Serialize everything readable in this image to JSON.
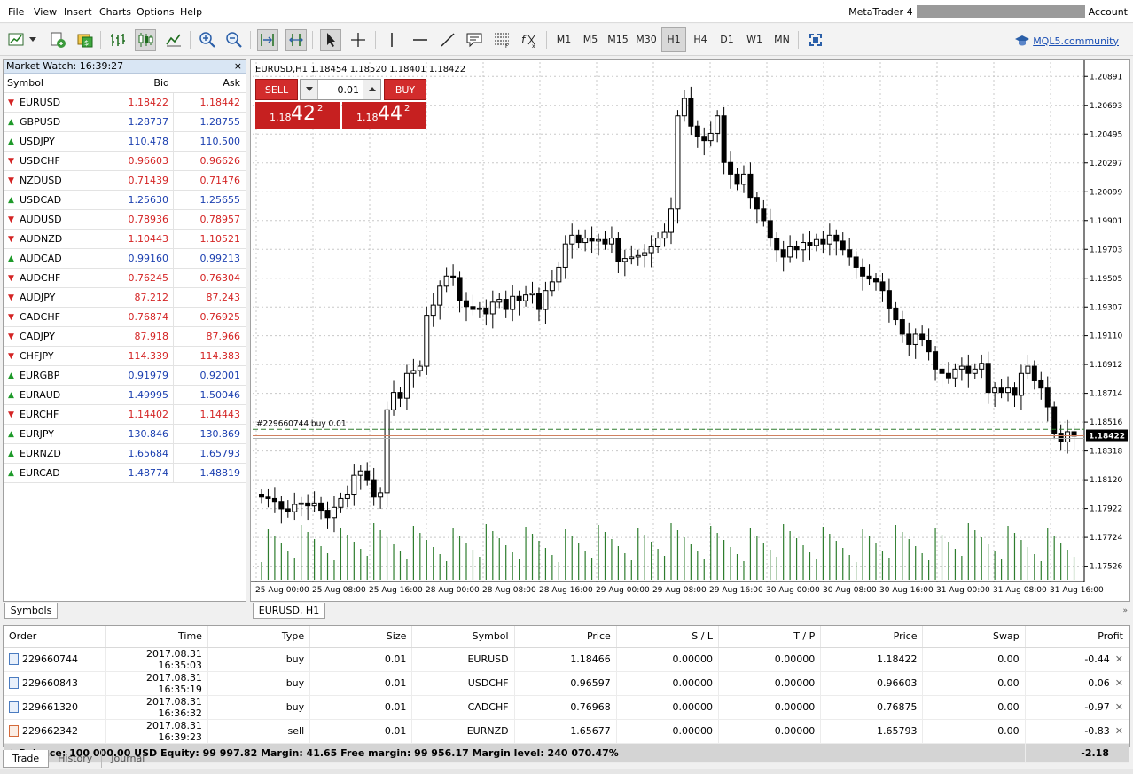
{
  "menu": [
    "File",
    "View",
    "Insert",
    "Charts",
    "Options",
    "Help"
  ],
  "account": {
    "app_name": "MetaTrader 4",
    "label": "Account"
  },
  "toolbar": {
    "timeframes": [
      "M1",
      "M5",
      "M15",
      "M30",
      "H1",
      "H4",
      "D1",
      "W1",
      "MN"
    ],
    "active_timeframe": "H1",
    "community_link": "MQL5.community"
  },
  "market_watch": {
    "title": "Market Watch: 16:39:27",
    "close": "×",
    "headers": {
      "symbol": "Symbol",
      "bid": "Bid",
      "ask": "Ask"
    },
    "rows": [
      {
        "symbol": "EURUSD",
        "bid": "1.18422",
        "ask": "1.18442",
        "dir": "down"
      },
      {
        "symbol": "GBPUSD",
        "bid": "1.28737",
        "ask": "1.28755",
        "dir": "up"
      },
      {
        "symbol": "USDJPY",
        "bid": "110.478",
        "ask": "110.500",
        "dir": "up"
      },
      {
        "symbol": "USDCHF",
        "bid": "0.96603",
        "ask": "0.96626",
        "dir": "down"
      },
      {
        "symbol": "NZDUSD",
        "bid": "0.71439",
        "ask": "0.71476",
        "dir": "down"
      },
      {
        "symbol": "USDCAD",
        "bid": "1.25630",
        "ask": "1.25655",
        "dir": "up"
      },
      {
        "symbol": "AUDUSD",
        "bid": "0.78936",
        "ask": "0.78957",
        "dir": "down"
      },
      {
        "symbol": "AUDNZD",
        "bid": "1.10443",
        "ask": "1.10521",
        "dir": "down"
      },
      {
        "symbol": "AUDCAD",
        "bid": "0.99160",
        "ask": "0.99213",
        "dir": "up"
      },
      {
        "symbol": "AUDCHF",
        "bid": "0.76245",
        "ask": "0.76304",
        "dir": "down"
      },
      {
        "symbol": "AUDJPY",
        "bid": "87.212",
        "ask": "87.243",
        "dir": "down"
      },
      {
        "symbol": "CADCHF",
        "bid": "0.76874",
        "ask": "0.76925",
        "dir": "down"
      },
      {
        "symbol": "CADJPY",
        "bid": "87.918",
        "ask": "87.966",
        "dir": "down"
      },
      {
        "symbol": "CHFJPY",
        "bid": "114.339",
        "ask": "114.383",
        "dir": "down"
      },
      {
        "symbol": "EURGBP",
        "bid": "0.91979",
        "ask": "0.92001",
        "dir": "up"
      },
      {
        "symbol": "EURAUD",
        "bid": "1.49995",
        "ask": "1.50046",
        "dir": "up"
      },
      {
        "symbol": "EURCHF",
        "bid": "1.14402",
        "ask": "1.14443",
        "dir": "down"
      },
      {
        "symbol": "EURJPY",
        "bid": "130.846",
        "ask": "130.869",
        "dir": "up"
      },
      {
        "symbol": "EURNZD",
        "bid": "1.65684",
        "ask": "1.65793",
        "dir": "up"
      },
      {
        "symbol": "EURCAD",
        "bid": "1.48774",
        "ask": "1.48819",
        "dir": "up"
      }
    ],
    "tab": "Symbols"
  },
  "chart": {
    "info": "EURUSD,H1  1.18454 1.18520 1.18401 1.18422",
    "tab": "EURUSD, H1",
    "order_line_label": "#229660744 buy 0.01",
    "sell_label": "SELL",
    "buy_label": "BUY",
    "lot": "0.01",
    "sell_price_prefix": "1.18",
    "sell_price_big": "42",
    "sell_price_sup": "2",
    "buy_price_prefix": "1.18",
    "buy_price_big": "44",
    "buy_price_sup": "2",
    "colors": {
      "bull": "#ffffff",
      "bear": "#000000",
      "volume": "#2e7d2e",
      "ask_line": "#d08060",
      "order_line": "#2e7d2e",
      "grid": "#c8c8c8"
    }
  },
  "chart_data": {
    "type": "candlestick",
    "symbol": "EURUSD",
    "timeframe": "H1",
    "ylim": [
      1.1742,
      1.2099
    ],
    "y_ticks": [
      "1.20891",
      "1.20693",
      "1.20495",
      "1.20297",
      "1.20099",
      "1.19901",
      "1.19703",
      "1.19505",
      "1.19307",
      "1.19110",
      "1.18912",
      "1.18714",
      "1.18516",
      "1.18318",
      "1.18120",
      "1.17922",
      "1.17724",
      "1.17526"
    ],
    "x_ticks": [
      "25 Aug 00:00",
      "25 Aug 08:00",
      "25 Aug 16:00",
      "28 Aug 00:00",
      "28 Aug 08:00",
      "28 Aug 16:00",
      "29 Aug 00:00",
      "29 Aug 08:00",
      "29 Aug 16:00",
      "30 Aug 00:00",
      "30 Aug 08:00",
      "30 Aug 16:00",
      "31 Aug 00:00",
      "31 Aug 08:00",
      "31 Aug 16:00"
    ],
    "current_price": "1.18422",
    "order_price": 1.18466,
    "close_series": [
      1.18,
      1.1799,
      1.1797,
      1.1792,
      1.179,
      1.1795,
      1.1796,
      1.1794,
      1.1796,
      1.1791,
      1.1786,
      1.1793,
      1.1799,
      1.1802,
      1.1815,
      1.1818,
      1.1812,
      1.18,
      1.1803,
      1.186,
      1.1872,
      1.1868,
      1.1885,
      1.1887,
      1.189,
      1.1925,
      1.1932,
      1.1945,
      1.1952,
      1.1951,
      1.1935,
      1.1931,
      1.1929,
      1.193,
      1.1926,
      1.1934,
      1.1936,
      1.1929,
      1.1938,
      1.1935,
      1.1939,
      1.194,
      1.1929,
      1.1942,
      1.1948,
      1.1958,
      1.1974,
      1.198,
      1.1975,
      1.1978,
      1.1976,
      1.1977,
      1.1974,
      1.1978,
      1.1962,
      1.1964,
      1.1965,
      1.1966,
      1.1968,
      1.1972,
      1.1978,
      1.1982,
      1.1998,
      1.2062,
      1.2074,
      1.2055,
      1.2048,
      1.2045,
      1.205,
      1.2062,
      1.203,
      1.2022,
      1.2015,
      1.2022,
      1.2006,
      1.1998,
      1.199,
      1.1978,
      1.197,
      1.1965,
      1.1972,
      1.197,
      1.1975,
      1.1973,
      1.1977,
      1.1974,
      1.198,
      1.1976,
      1.197,
      1.1965,
      1.1958,
      1.1952,
      1.195,
      1.1948,
      1.1942,
      1.193,
      1.1922,
      1.1912,
      1.1905,
      1.1912,
      1.1908,
      1.19,
      1.1888,
      1.1885,
      1.1882,
      1.1888,
      1.189,
      1.1885,
      1.1888,
      1.1892,
      1.1872,
      1.1875,
      1.1872,
      1.1875,
      1.187,
      1.1885,
      1.189,
      1.188,
      1.1875,
      1.1862,
      1.1844,
      1.1838,
      1.1845,
      1.1842
    ]
  },
  "terminal": {
    "headers": [
      "Order",
      "Time",
      "Type",
      "Size",
      "Symbol",
      "Price",
      "S / L",
      "T / P",
      "Price",
      "Swap",
      "Profit"
    ],
    "rows": [
      {
        "order": "229660744",
        "time": "2017.08.31 16:35:03",
        "type": "buy",
        "size": "0.01",
        "symbol": "EURUSD",
        "price": "1.18466",
        "sl": "0.00000",
        "tp": "0.00000",
        "cur": "1.18422",
        "swap": "0.00",
        "profit": "-0.44"
      },
      {
        "order": "229660843",
        "time": "2017.08.31 16:35:19",
        "type": "buy",
        "size": "0.01",
        "symbol": "USDCHF",
        "price": "0.96597",
        "sl": "0.00000",
        "tp": "0.00000",
        "cur": "0.96603",
        "swap": "0.00",
        "profit": "0.06"
      },
      {
        "order": "229661320",
        "time": "2017.08.31 16:36:32",
        "type": "buy",
        "size": "0.01",
        "symbol": "CADCHF",
        "price": "0.76968",
        "sl": "0.00000",
        "tp": "0.00000",
        "cur": "0.76875",
        "swap": "0.00",
        "profit": "-0.97"
      },
      {
        "order": "229662342",
        "time": "2017.08.31 16:39:23",
        "type": "sell",
        "size": "0.01",
        "symbol": "EURNZD",
        "price": "1.65677",
        "sl": "0.00000",
        "tp": "0.00000",
        "cur": "1.65793",
        "swap": "0.00",
        "profit": "-0.83"
      }
    ],
    "balance_line": "Balance: 100 000.00 USD  Equity: 99 997.82  Margin: 41.65  Free margin: 99 956.17  Margin level: 240 070.47%",
    "total_profit": "-2.18",
    "tabs": [
      "Trade",
      "History",
      "Journal"
    ]
  }
}
